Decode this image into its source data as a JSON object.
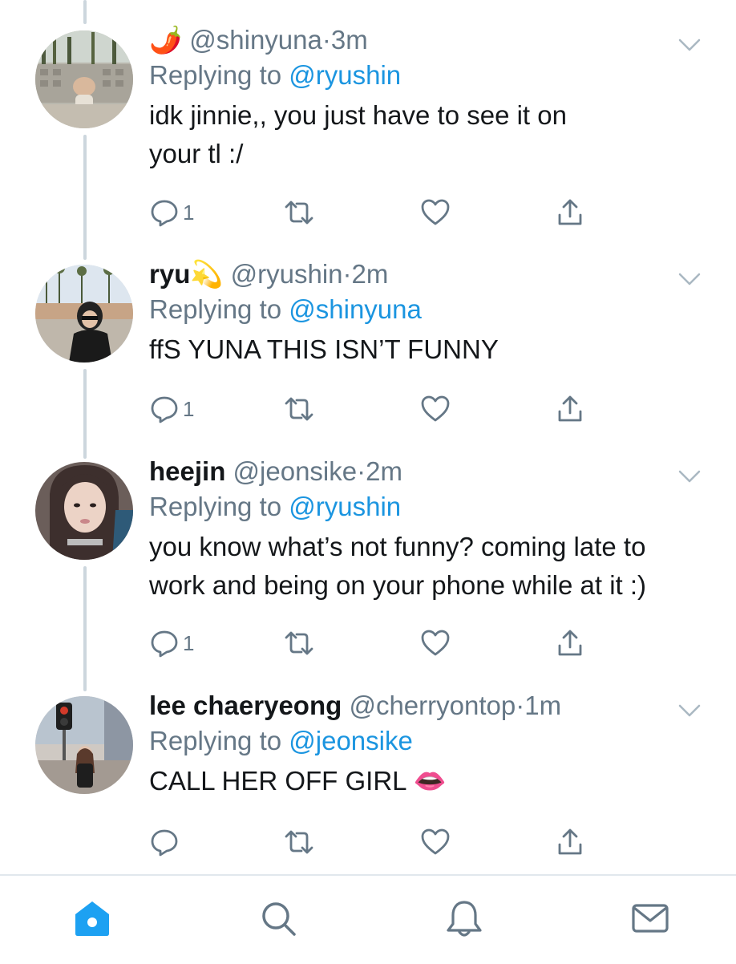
{
  "tweets": [
    {
      "name": "",
      "emoji": "🌶️",
      "handle": "@shinyuna",
      "dot": "·",
      "time": "3m",
      "replying_prefix": "Replying to ",
      "replying_to": "@ryushin",
      "text_lines": [
        "idk jinnie,, you just have to see it on",
        "your tl :/"
      ],
      "reply_count": "1"
    },
    {
      "name": "ryu",
      "emoji": "💫",
      "handle": "@ryushin",
      "dot": "·",
      "time": "2m",
      "replying_prefix": "Replying to ",
      "replying_to": "@shinyuna",
      "text_lines": [
        "ffS YUNA THIS ISN’T FUNNY"
      ],
      "reply_count": "1"
    },
    {
      "name": "heejin",
      "emoji": "",
      "handle": "@jeonsike",
      "dot": "·",
      "time": "2m",
      "replying_prefix": "Replying to ",
      "replying_to": "@ryushin",
      "text_lines": [
        "you know what’s not funny? coming late to",
        "work and being on your phone while at it :)"
      ],
      "reply_count": "1"
    },
    {
      "name": "lee chaeryeong",
      "emoji": "",
      "handle": "@cherryontop",
      "dot": "·",
      "time": "1m",
      "replying_prefix": "Replying to ",
      "replying_to": "@jeonsike",
      "text_lines": [
        "CALL HER OFF GIRL 👄"
      ],
      "reply_count": ""
    }
  ],
  "icons": {
    "reply": "reply-icon",
    "retweet": "retweet-icon",
    "like": "heart-icon",
    "share": "share-icon",
    "more": "chevron-down-icon"
  },
  "tabbar": {
    "items": [
      "home-icon",
      "search-icon",
      "notifications-icon",
      "messages-icon"
    ],
    "active": "home-icon"
  },
  "colors": {
    "accent": "#1da1f2",
    "mention": "#1b95e0",
    "muted": "#657786",
    "thread_line": "#ccd6dd",
    "icon": "#657786"
  }
}
